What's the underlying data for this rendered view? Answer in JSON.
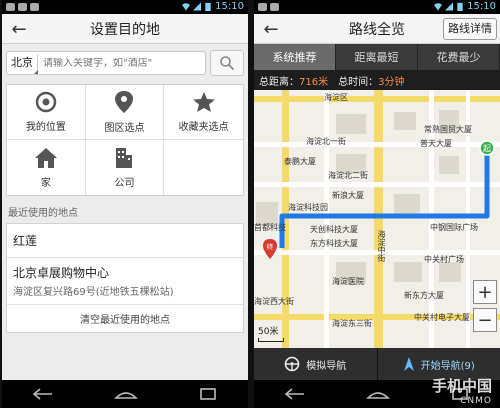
{
  "status": {
    "time": "15:10"
  },
  "left": {
    "title": "设置目的地",
    "city": "北京",
    "search_placeholder": "请输入关键字，如\"酒店\"",
    "grid": [
      {
        "label": "我的位置",
        "icon": "target-icon"
      },
      {
        "label": "图区选点",
        "icon": "map-pin-icon"
      },
      {
        "label": "收藏夹选点",
        "icon": "star-icon"
      },
      {
        "label": "家",
        "icon": "home-icon"
      },
      {
        "label": "公司",
        "icon": "building-icon"
      }
    ],
    "recent_label": "最近使用的地点",
    "recent": [
      {
        "name": "红莲"
      },
      {
        "name": "北京卓展购物中心",
        "addr": "海淀区复兴路69号(近地铁五棵松站)"
      }
    ],
    "clear_label": "清空最近使用的地点"
  },
  "right": {
    "title": "路线全览",
    "detail_label": "路线详情",
    "tabs": [
      "系统推荐",
      "距离最短",
      "花费最少"
    ],
    "summary": {
      "distance_label": "总距离：",
      "distance_value": "716米",
      "time_label": "总时间：",
      "time_value": "3分钟"
    },
    "map_labels": {
      "l1": "海淀区",
      "l2": "海淀北一街",
      "l3": "海淀北二街",
      "l4": "泰鹏大厦",
      "l5": "新浪大厦",
      "l6": "海淀科技园",
      "l7": "东方科技大厦",
      "l8": "天创科技大厦",
      "l9": "海淀中街",
      "l10": "中钢国际广场",
      "l11": "中关村广场",
      "l12": "新东方大厦",
      "l13": "中关村电子大厦",
      "l14": "普天大厦",
      "l15": "海淀医院",
      "l16": "常熟国贸大厦",
      "l17": "首都科技",
      "l18": "海淀西大街",
      "l19": "海淀东三街"
    },
    "scale": "50米",
    "simulate_label": "模拟导航",
    "start_label": "开始导航(9)"
  },
  "watermark": {
    "main": "手机中国",
    "sub": "CNMO"
  }
}
